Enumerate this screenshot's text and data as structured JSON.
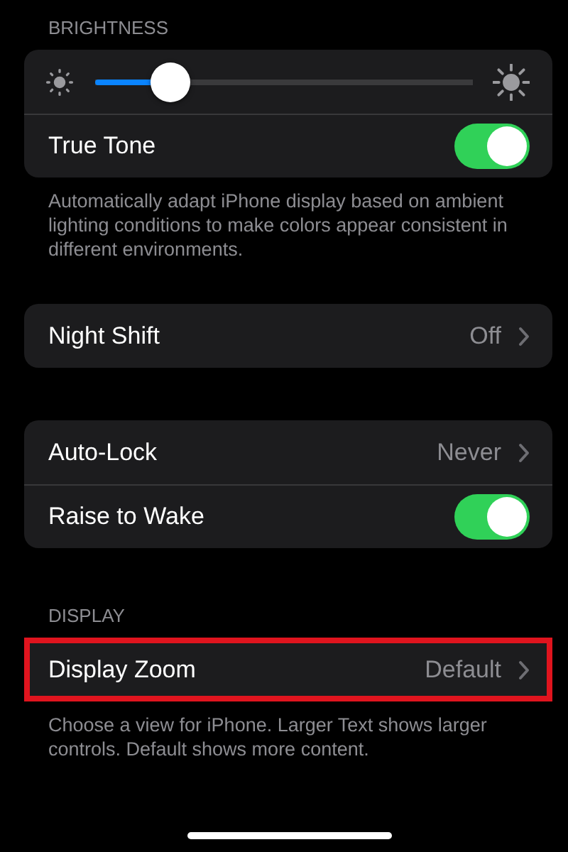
{
  "sections": [
    {
      "header": "BRIGHTNESS",
      "rows": [
        {
          "kind": "slider",
          "level": 0.2
        },
        {
          "kind": "toggle",
          "label": "True Tone",
          "on": true
        }
      ],
      "footer": "Automatically adapt iPhone display based on ambient lighting conditions to make colors appear consistent in different environments."
    },
    {
      "rows": [
        {
          "kind": "link",
          "label": "Night Shift",
          "value": "Off",
          "highlighted": false
        }
      ]
    },
    {
      "rows": [
        {
          "kind": "link",
          "label": "Auto-Lock",
          "value": "Never",
          "highlighted": false
        },
        {
          "kind": "toggle",
          "label": "Raise to Wake",
          "on": true
        }
      ]
    },
    {
      "header": "DISPLAY",
      "rows": [
        {
          "kind": "link",
          "label": "Display Zoom",
          "value": "Default",
          "highlighted": true
        }
      ],
      "footer": "Choose a view for iPhone. Larger Text shows larger controls. Default shows more content."
    }
  ]
}
